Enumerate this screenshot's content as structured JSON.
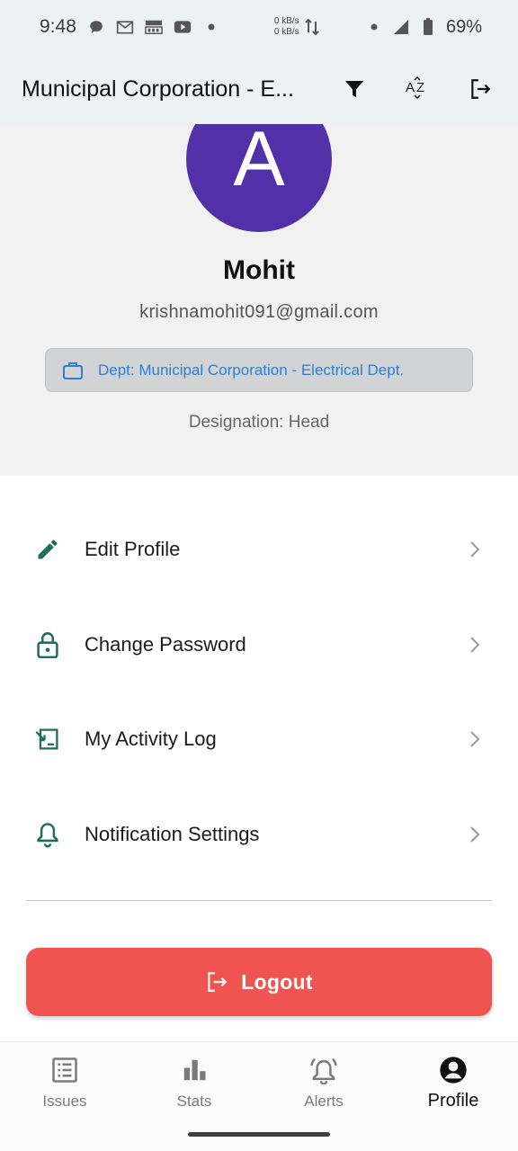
{
  "status_bar": {
    "time": "9:48",
    "net_up": "0 kB/s",
    "net_down": "0 kB/s",
    "battery": "69%"
  },
  "app_bar": {
    "title": "Municipal Corporation - E..."
  },
  "profile": {
    "avatar_letter": "A",
    "name": "Mohit",
    "email": "krishnamohit091@gmail.com",
    "department": "Dept: Municipal Corporation - Electrical Dept.",
    "designation": "Designation: Head"
  },
  "menu": {
    "items": [
      {
        "label": "Edit Profile",
        "icon": "pencil-icon"
      },
      {
        "label": "Change Password",
        "icon": "lock-icon"
      },
      {
        "label": "My Activity Log",
        "icon": "activity-log-icon"
      },
      {
        "label": "Notification Settings",
        "icon": "bell-icon"
      }
    ]
  },
  "logout": {
    "label": "Logout"
  },
  "bottom_nav": {
    "items": [
      {
        "label": "Issues",
        "icon": "list-icon"
      },
      {
        "label": "Stats",
        "icon": "bar-chart-icon"
      },
      {
        "label": "Alerts",
        "icon": "alarm-bell-icon"
      },
      {
        "label": "Profile",
        "icon": "account-circle-icon"
      }
    ],
    "active": "Profile"
  },
  "colors": {
    "accent_teal": "#1e6f5c",
    "avatar_bg": "#5130a8",
    "logout_bg": "#ef5450",
    "dept_text": "#2f7fd0"
  }
}
